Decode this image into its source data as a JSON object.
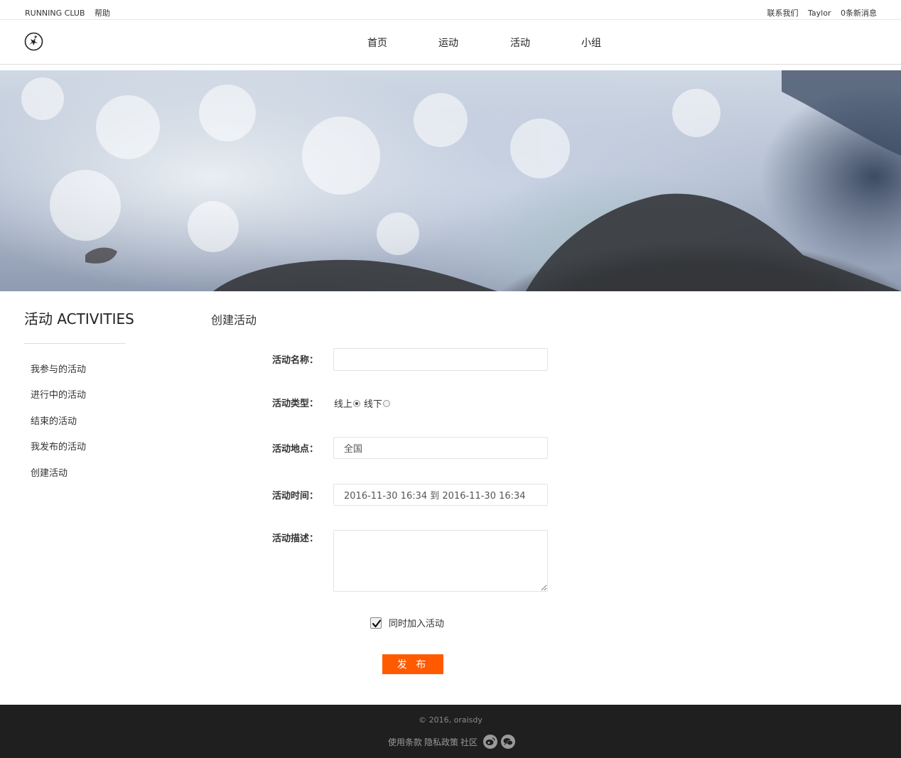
{
  "topbar": {
    "brand": "RUNNING CLUB",
    "help": "帮助",
    "contact": "联系我们",
    "user": "Taylor",
    "messages": "0条新消息"
  },
  "nav": {
    "items": [
      {
        "label": "首页"
      },
      {
        "label": "运动"
      },
      {
        "label": "活动"
      },
      {
        "label": "小组"
      }
    ]
  },
  "sidebar": {
    "title": "活动 ACTIVITIES",
    "items": [
      {
        "label": "我参与的活动"
      },
      {
        "label": "进行中的活动"
      },
      {
        "label": "结束的活动"
      },
      {
        "label": "我发布的活动"
      },
      {
        "label": "创建活动"
      }
    ]
  },
  "form": {
    "title": "创建活动",
    "name_label": "活动名称：",
    "name_value": "",
    "type_label": "活动类型：",
    "type_online": "线上",
    "type_offline": "线下",
    "type_selected": "线上",
    "location_label": "活动地点：",
    "location_value": "全国",
    "time_label": "活动时间：",
    "time_value": "2016-11-30 16:34 到 2016-11-30 16:34",
    "desc_label": "活动描述：",
    "desc_value": "",
    "join_label": "同时加入活动",
    "join_checked": true,
    "submit_label": "发 布",
    "submit_color": "#ff5a00"
  },
  "footer": {
    "copyright": "© 2016, oraisdy",
    "terms": "使用条款",
    "privacy": "隐私政策",
    "community": "社区",
    "icons": [
      "weibo-icon",
      "wechat-icon"
    ]
  }
}
